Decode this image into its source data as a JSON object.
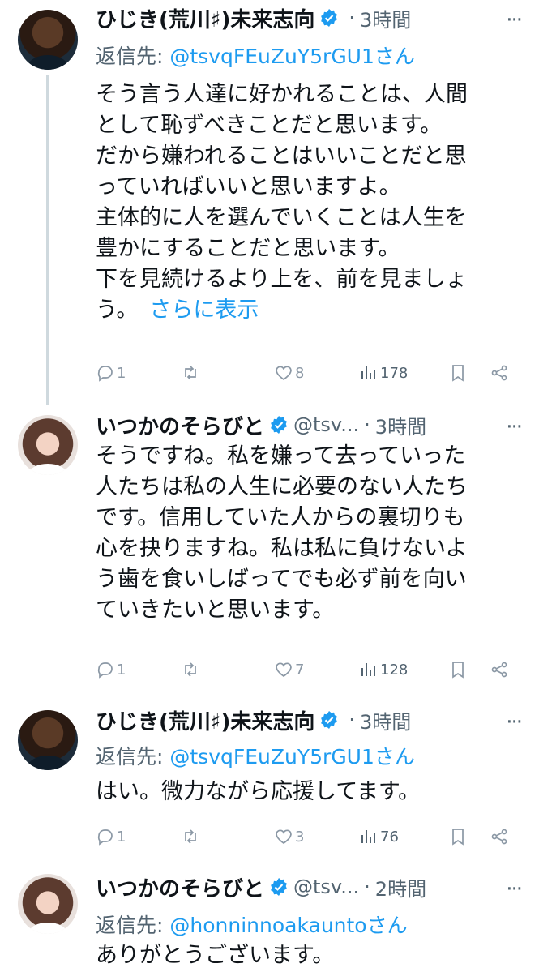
{
  "tweets": [
    {
      "name": "ひじき(荒川♯)未来志向",
      "handle": "",
      "separator": "·",
      "time": "3時間",
      "reply_prefix": "返信先: ",
      "reply_to": "@tsvqFEuZuY5rGU1さん",
      "body_lines": [
        "そう言う人達に好かれることは、人間",
        "として恥ずべきことだと思います。",
        "だから嫌われることはいいことだと思",
        "っていればいいと思いますよ。",
        "主体的に人を選んでいくことは人生を",
        "豊かにすることだと思います。",
        "下を見続けるより上を、前を見ましょ"
      ],
      "last_line": "う。",
      "show_more": "さらに表示",
      "replies": "1",
      "retweets": "",
      "likes": "8",
      "views": "178"
    },
    {
      "name": "いつかのそらびと",
      "handle": "@tsv...",
      "separator": "·",
      "time": "3時間",
      "body_lines": [
        "そうですね。私を嫌って去っていった",
        "人たちは私の人生に必要のない人たち",
        "です。信用していた人からの裏切りも",
        "心を抉りますね。私は私に負けないよ",
        "う歯を食いしばってでも必ず前を向い",
        "ていきたいと思います。"
      ],
      "replies": "1",
      "retweets": "",
      "likes": "7",
      "views": "128"
    },
    {
      "name": "ひじき(荒川♯)未来志向",
      "handle": "",
      "separator": "·",
      "time": "3時間",
      "reply_prefix": "返信先: ",
      "reply_to": "@tsvqFEuZuY5rGU1さん",
      "body_lines": [
        "はい。微力ながら応援してます。"
      ],
      "replies": "1",
      "retweets": "",
      "likes": "3",
      "views": "76"
    },
    {
      "name": "いつかのそらびと",
      "handle": "@tsv...",
      "separator": "·",
      "time": "2時間",
      "reply_prefix": "返信先: ",
      "reply_to": "@honninnoakauntoさん",
      "body_lines": [
        "ありがとうございます。"
      ]
    }
  ],
  "more_icon": "···",
  "colors": {
    "accent": "#1d9bf0",
    "muted": "#536471",
    "text": "#0f1419"
  }
}
